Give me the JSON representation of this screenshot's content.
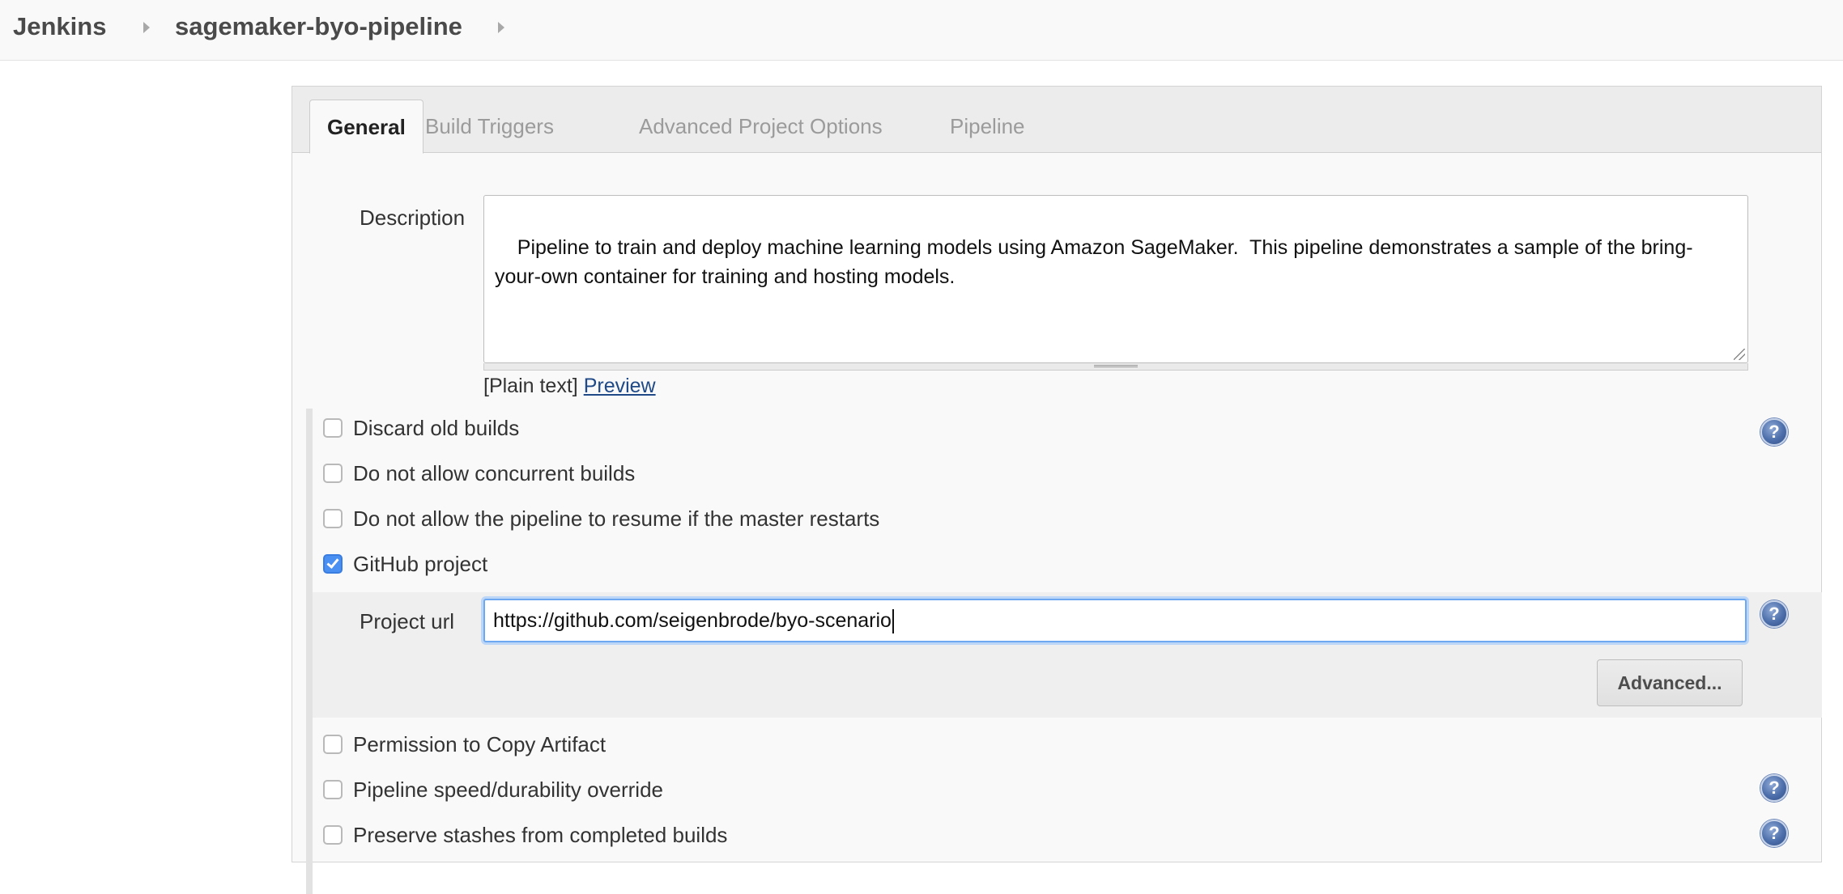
{
  "breadcrumb": {
    "items": [
      "Jenkins",
      "sagemaker-byo-pipeline"
    ]
  },
  "tabs": [
    "General",
    "Build Triggers",
    "Advanced Project Options",
    "Pipeline"
  ],
  "active_tab": "General",
  "description": {
    "label": "Description",
    "value": "Pipeline to train and deploy machine learning models using Amazon SageMaker.  This pipeline demonstrates a sample of the bring-your-own container for training and hosting models.",
    "format_text": "[Plain text]",
    "preview_link": "Preview"
  },
  "options": {
    "discard_old_builds": {
      "label": "Discard old builds",
      "checked": false
    },
    "no_concurrent_builds": {
      "label": "Do not allow concurrent builds",
      "checked": false
    },
    "no_resume": {
      "label": "Do not allow the pipeline to resume if the master restarts",
      "checked": false
    },
    "github_project": {
      "label": "GitHub project",
      "checked": true
    },
    "copy_artifact": {
      "label": "Permission to Copy Artifact",
      "checked": false
    },
    "speed_override": {
      "label": "Pipeline speed/durability override",
      "checked": false
    },
    "preserve_stashes": {
      "label": "Preserve stashes from completed builds",
      "checked": false
    }
  },
  "github": {
    "project_url_label": "Project url",
    "project_url_value": "https://github.com/seigenbrode/byo-scenario",
    "advanced_button": "Advanced..."
  },
  "help_icon_glyph": "?",
  "colors": {
    "accent": "#4a8ff2",
    "focus_ring": "#6da8f0",
    "help_icon": "#4c6eaa"
  }
}
